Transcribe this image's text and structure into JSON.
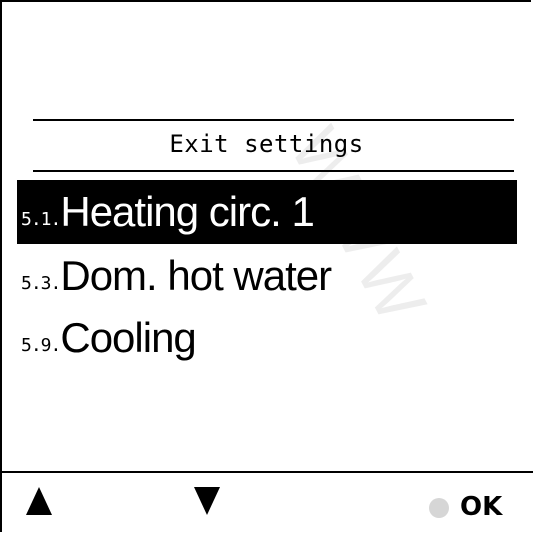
{
  "screen": {
    "title": "Exit settings"
  },
  "menu": {
    "items": [
      {
        "number": "5.1.",
        "label": "Heating circ. 1",
        "selected": true
      },
      {
        "number": "5.3.",
        "label": "Dom. hot water",
        "selected": false
      },
      {
        "number": "5.9.",
        "label": "Cooling",
        "selected": false
      }
    ]
  },
  "footer": {
    "up_icon": "triangle-up-icon",
    "down_icon": "triangle-down-icon",
    "ok_label": "OK"
  },
  "watermark": {
    "text": "WWW"
  },
  "colors": {
    "foreground": "#000000",
    "background": "#ffffff",
    "selection_background": "#000000",
    "selection_text": "#ffffff",
    "ok_dot": "#d6d6d6"
  }
}
